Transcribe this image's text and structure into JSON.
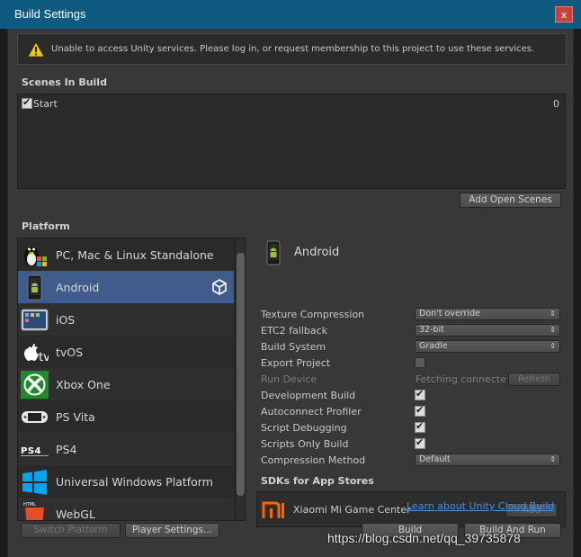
{
  "window": {
    "title": "Build Settings",
    "close_glyph": "x"
  },
  "warning": {
    "icon": "warning-triangle-icon",
    "text": "Unable to access Unity services. Please log in, or request membership to this project to use these services."
  },
  "scenes": {
    "header": "Scenes In Build",
    "items": [
      {
        "name": "Start",
        "index": "0",
        "checked": true
      }
    ],
    "add_open_scenes_label": "Add Open Scenes"
  },
  "platform": {
    "header": "Platform",
    "items": [
      {
        "name": "PC, Mac & Linux Standalone",
        "icon": "linux-tux-icon"
      },
      {
        "name": "Android",
        "icon": "android-phone-icon",
        "selected": true,
        "current": true
      },
      {
        "name": "iOS",
        "icon": "ipad-icon"
      },
      {
        "name": "tvOS",
        "icon": "apple-tv-icon"
      },
      {
        "name": "Xbox One",
        "icon": "xbox-icon"
      },
      {
        "name": "PS Vita",
        "icon": "ps-vita-icon"
      },
      {
        "name": "PS4",
        "icon": "ps4-icon"
      },
      {
        "name": "Universal Windows Platform",
        "icon": "windows-icon"
      },
      {
        "name": "WebGL",
        "icon": "html5-icon"
      }
    ]
  },
  "settings": {
    "platform_title": "Android",
    "texture_compression": {
      "label": "Texture Compression",
      "value": "Don't override"
    },
    "etc2_fallback": {
      "label": "ETC2 fallback",
      "value": "32-bit"
    },
    "build_system": {
      "label": "Build System",
      "value": "Gradle"
    },
    "export_project": {
      "label": "Export Project",
      "checked": false
    },
    "run_device": {
      "label": "Run Device",
      "value": "Fetching connected devices",
      "refresh_label": "Refresh"
    },
    "development_build": {
      "label": "Development Build",
      "checked": true
    },
    "autoconnect_profiler": {
      "label": "Autoconnect Profiler",
      "checked": true
    },
    "script_debugging": {
      "label": "Script Debugging",
      "checked": true
    },
    "scripts_only_build": {
      "label": "Scripts Only Build",
      "checked": true
    },
    "compression_method": {
      "label": "Compression Method",
      "value": "Default"
    }
  },
  "sdks": {
    "header": "SDKs for App Stores",
    "items": [
      {
        "name": "Xiaomi Mi Game Center",
        "icon": "xiaomi-mi-icon",
        "add_label": "Add"
      }
    ],
    "link_text": "Learn about Unity Cloud Build"
  },
  "footer": {
    "switch_platform_label": "Switch Platform",
    "player_settings_label": "Player Settings...",
    "build_label": "Build",
    "build_and_run_label": "Build And Run"
  },
  "watermark": {
    "text": "https://blog.csdn.net/qq_39735878"
  },
  "colors": {
    "titlebar": "#0f5a80",
    "panel": "#383838",
    "selection": "#3f5c8c",
    "link": "#4d8fe0",
    "close": "#c7423a"
  }
}
